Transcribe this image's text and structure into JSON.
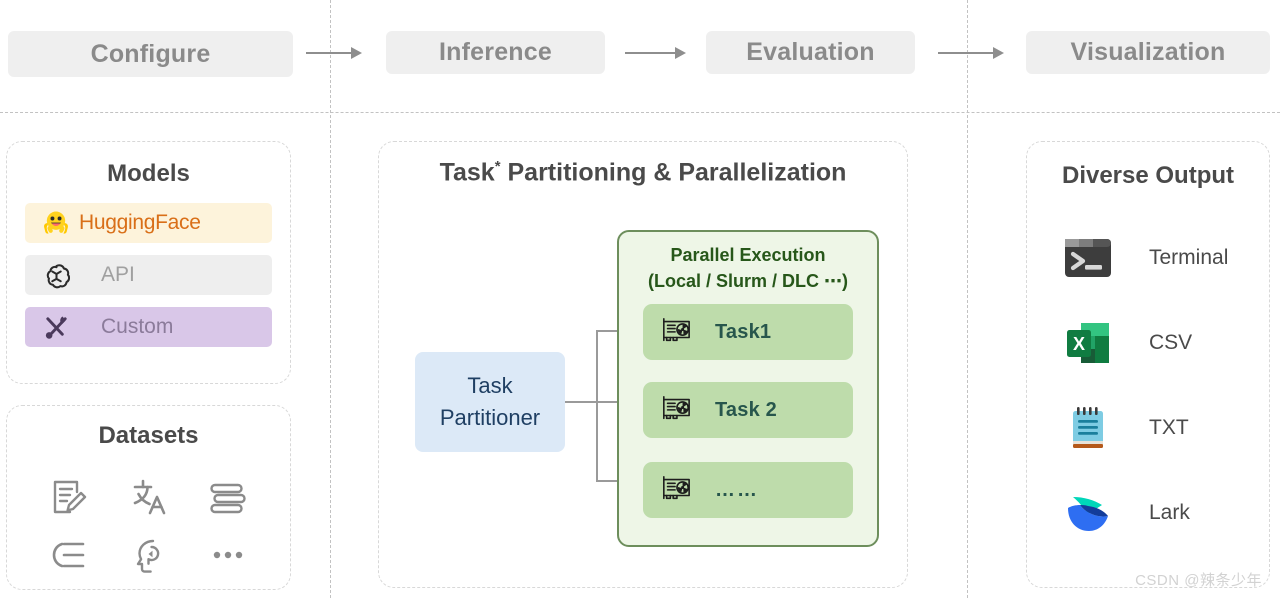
{
  "pipeline": {
    "stages": [
      {
        "label": "Configure"
      },
      {
        "label": "Inference"
      },
      {
        "label": "Evaluation"
      },
      {
        "label": "Visualization"
      }
    ]
  },
  "models_panel": {
    "title": "Models",
    "items": [
      {
        "label": "HuggingFace",
        "icon": "hugging-face-icon",
        "bg": "#fdf3db",
        "fg": "#d96f18"
      },
      {
        "label": "API",
        "icon": "openai-knot-icon",
        "bg": "#eeeeee",
        "fg": "#a0a0a0"
      },
      {
        "label": "Custom",
        "icon": "tools-icon",
        "bg": "#d9c7e8",
        "fg": "#8b7b9a"
      }
    ]
  },
  "datasets_panel": {
    "title": "Datasets",
    "icons": [
      {
        "name": "note-edit-icon"
      },
      {
        "name": "translate-icon"
      },
      {
        "name": "books-stack-icon"
      },
      {
        "name": "summarize-list-icon"
      },
      {
        "name": "reasoning-head-icon"
      },
      {
        "name": "ellipsis-icon"
      }
    ]
  },
  "center_panel": {
    "title_main": "Task",
    "title_sup": "*",
    "title_rest": " Partitioning & Parallelization",
    "partitioner": {
      "line1": "Task",
      "line2": "Partitioner"
    },
    "parallel_execution": {
      "title_line1": "Parallel Execution",
      "title_line2": "(Local / Slurm / DLC ⋯)",
      "tasks": [
        {
          "label": "Task1",
          "icon": "gpu-card-icon"
        },
        {
          "label": "Task 2",
          "icon": "gpu-card-icon"
        },
        {
          "label": "……",
          "icon": "gpu-card-icon"
        }
      ]
    }
  },
  "output_panel": {
    "title": "Diverse Output",
    "items": [
      {
        "label": "Terminal",
        "icon": "terminal-icon"
      },
      {
        "label": "CSV",
        "icon": "excel-csv-icon"
      },
      {
        "label": "TXT",
        "icon": "notepad-txt-icon"
      },
      {
        "label": "Lark",
        "icon": "lark-bird-icon"
      }
    ]
  },
  "watermark": {
    "text": "CSDN @辣条少年"
  },
  "colors": {
    "stage_box_bg": "#efefef",
    "stage_box_fg": "#8a8a8a",
    "partitioner_bg": "#dce9f7",
    "partitioner_fg": "#1f3f63",
    "pexec_bg": "#eef6e7",
    "pexec_border": "#6d8e5c",
    "pexec_fg": "#27571a",
    "task_card_bg": "#bedcab",
    "task_card_fg": "#27564c",
    "divider": "#c2c2c2",
    "panel_border": "#d8d8d8"
  }
}
